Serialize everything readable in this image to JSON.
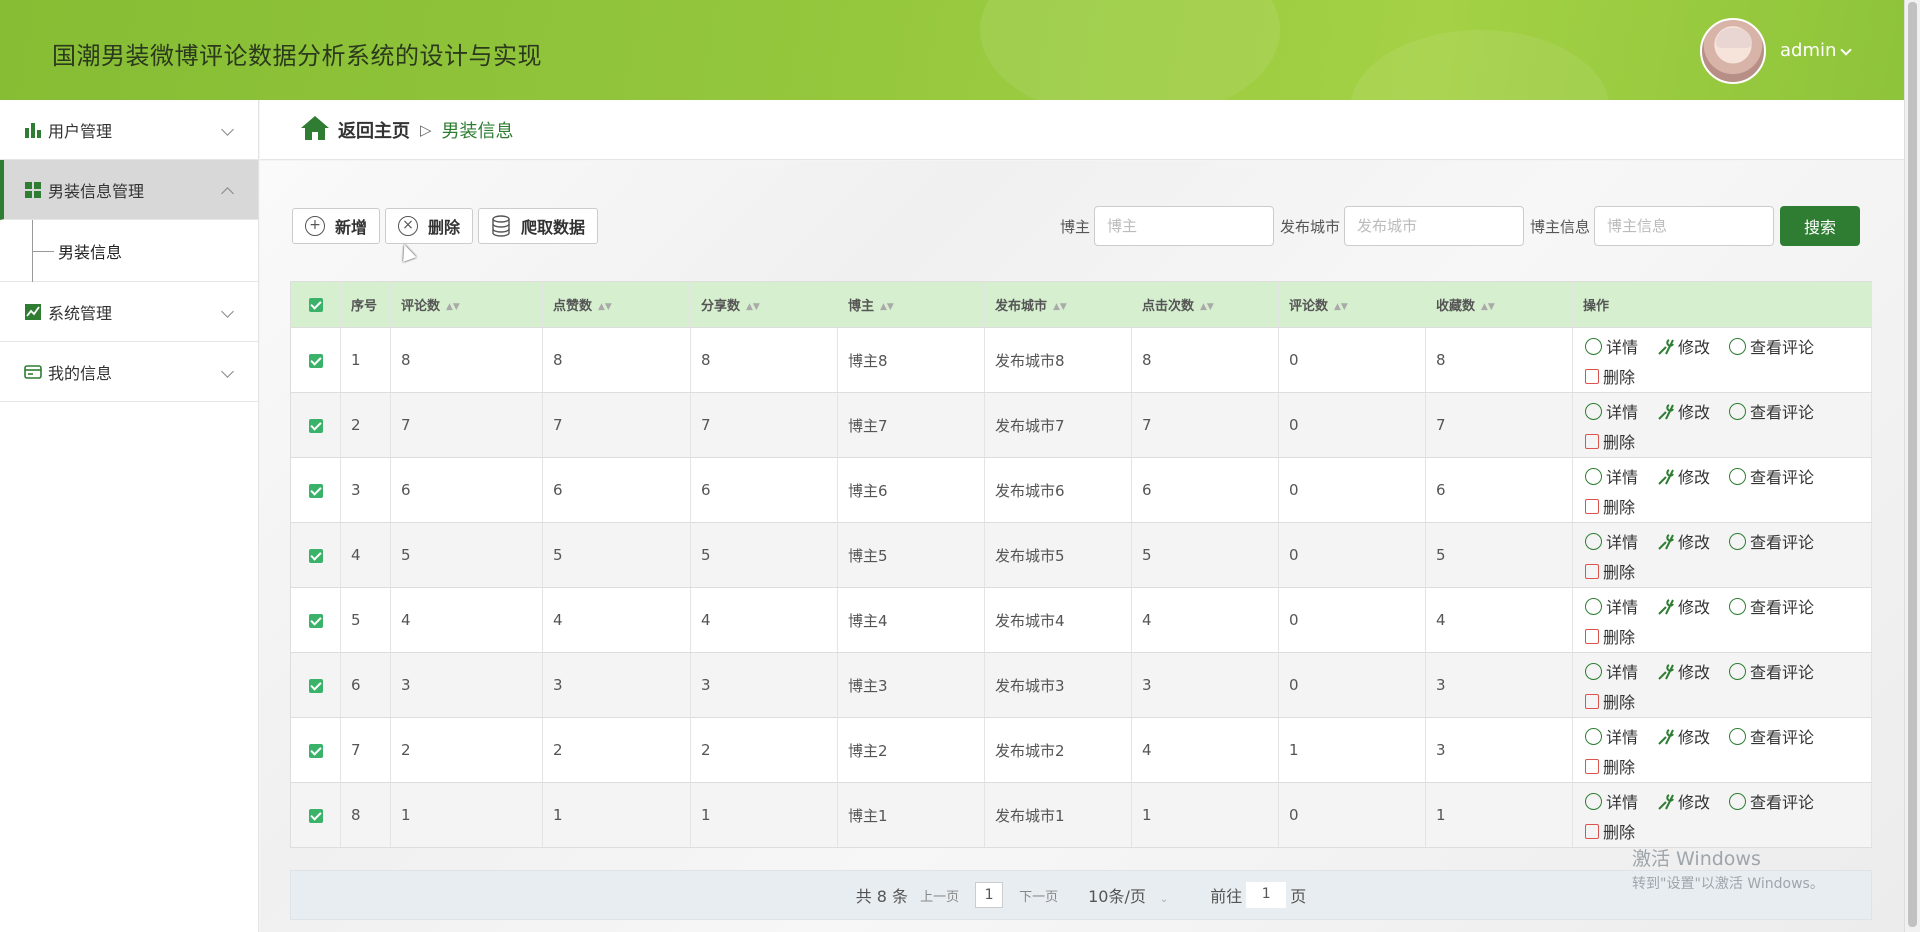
{
  "header": {
    "title": "国潮男装微博评论数据分析系统的设计与实现",
    "user": "admin"
  },
  "sidebar": {
    "items": [
      {
        "label": "用户管理",
        "icon": "bar-chart-icon"
      },
      {
        "label": "男装信息管理",
        "icon": "grid-icon",
        "active": true,
        "children": [
          {
            "label": "男装信息"
          }
        ]
      },
      {
        "label": "系统管理",
        "icon": "line-chart-icon"
      },
      {
        "label": "我的信息",
        "icon": "card-icon"
      }
    ]
  },
  "breadcrumb": {
    "home": "返回主页",
    "separator": "▷",
    "current": "男装信息"
  },
  "toolbar": {
    "add": "新增",
    "delete": "删除",
    "crawl": "爬取数据"
  },
  "search": {
    "blogger_label": "博主",
    "blogger_placeholder": "博主",
    "city_label": "发布城市",
    "city_placeholder": "发布城市",
    "info_label": "博主信息",
    "info_placeholder": "博主信息",
    "button": "搜索"
  },
  "table": {
    "columns": [
      "序号",
      "评论数",
      "点赞数",
      "分享数",
      "博主",
      "发布城市",
      "点击次数",
      "评论数",
      "收藏数",
      "操作"
    ],
    "rows": [
      [
        "1",
        "8",
        "8",
        "8",
        "博主8",
        "发布城市8",
        "8",
        "0",
        "8"
      ],
      [
        "2",
        "7",
        "7",
        "7",
        "博主7",
        "发布城市7",
        "7",
        "0",
        "7"
      ],
      [
        "3",
        "6",
        "6",
        "6",
        "博主6",
        "发布城市6",
        "6",
        "0",
        "6"
      ],
      [
        "4",
        "5",
        "5",
        "5",
        "博主5",
        "发布城市5",
        "5",
        "0",
        "5"
      ],
      [
        "5",
        "4",
        "4",
        "4",
        "博主4",
        "发布城市4",
        "4",
        "0",
        "4"
      ],
      [
        "6",
        "3",
        "3",
        "3",
        "博主3",
        "发布城市3",
        "3",
        "0",
        "3"
      ],
      [
        "7",
        "2",
        "2",
        "2",
        "博主2",
        "发布城市2",
        "4",
        "1",
        "3"
      ],
      [
        "8",
        "1",
        "1",
        "1",
        "博主1",
        "发布城市1",
        "1",
        "0",
        "1"
      ]
    ],
    "actions": {
      "detail": "详情",
      "edit": "修改",
      "comments": "查看评论",
      "delete": "删除"
    }
  },
  "pager": {
    "total": "共 8 条",
    "prev": "上一页",
    "page": "1",
    "next": "下一页",
    "size": "10条/页",
    "goto_prefix": "前往",
    "goto_value": "1",
    "goto_suffix": "页"
  },
  "watermark": {
    "line1": "激活 Windows",
    "line2": "转到\"设置\"以激活 Windows。"
  },
  "colors": {
    "header": "#93c63c",
    "accent": "#2e7d32",
    "table_header": "#d6efcf",
    "checkbox": "#3bb26a"
  }
}
